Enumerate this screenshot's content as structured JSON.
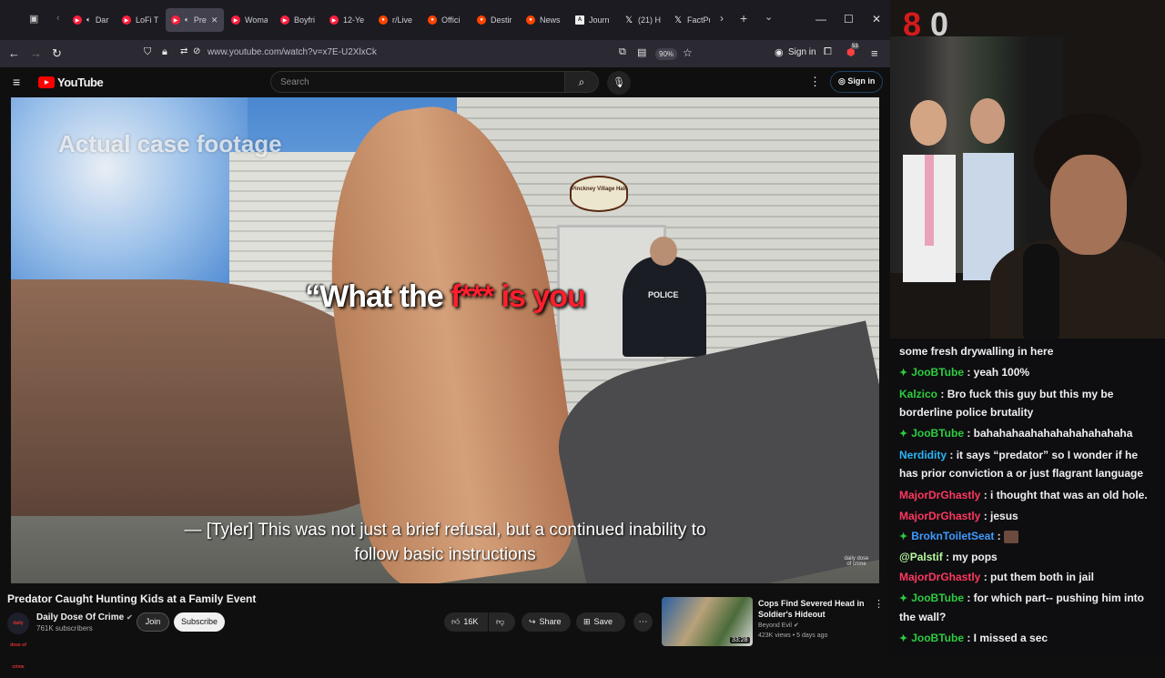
{
  "browser": {
    "tabs": [
      {
        "label": "Dark S",
        "favicon": "youtube",
        "audio": true,
        "active": false
      },
      {
        "label": "LoFi Ti",
        "favicon": "youtube",
        "audio": false,
        "active": false
      },
      {
        "label": "Pre",
        "favicon": "youtube",
        "audio": true,
        "active": true
      },
      {
        "label": "Woma",
        "favicon": "youtube",
        "audio": false,
        "active": false
      },
      {
        "label": "Boyfri",
        "favicon": "youtube",
        "audio": false,
        "active": false
      },
      {
        "label": "12-Ye",
        "favicon": "youtube",
        "audio": false,
        "active": false
      },
      {
        "label": "r/Live",
        "favicon": "reddit",
        "audio": false,
        "active": false
      },
      {
        "label": "Offici",
        "favicon": "reddit",
        "audio": false,
        "active": false
      },
      {
        "label": "Destir",
        "favicon": "reddit",
        "audio": false,
        "active": false
      },
      {
        "label": "News",
        "favicon": "reddit",
        "audio": false,
        "active": false
      },
      {
        "label": "Journ",
        "favicon": "doc",
        "audio": false,
        "active": false
      },
      {
        "label": "(21) H",
        "favicon": "x",
        "audio": false,
        "active": false
      },
      {
        "label": "FactPu",
        "favicon": "x",
        "audio": false,
        "active": false
      }
    ],
    "url": "www.youtube.com/watch?v=x7E-U2XlxCk",
    "zoom": "90%",
    "sign_in": "Sign in",
    "extension_badge": "53"
  },
  "youtube": {
    "logo_text": "YouTube",
    "search_placeholder": "Search",
    "sign_in": "Sign in",
    "video": {
      "watermark": "Actual case footage",
      "caption_white": "“What the ",
      "caption_red": "f*** is you",
      "subtitle_line1": "— [Tyler] This was not just a brief refusal, but a continued inability to",
      "subtitle_line2": "follow basic instructions",
      "sign_text": "Pinckney Village Hall",
      "police_label": "POLICE",
      "corner_logo": "daily dose of crime"
    },
    "title": "Predator Caught Hunting Kids at a Family Event",
    "channel": {
      "name": "Daily Dose Of Crime",
      "subscribers": "761K subscribers",
      "avatar_text": "daily dose of crime",
      "join_label": "Join",
      "subscribe_label": "Subscribe"
    },
    "actions": {
      "likes": "16K",
      "share": "Share",
      "save": "Save"
    },
    "recommended": {
      "title": "Cops Find Severed Head in Soldier's Hideout",
      "channel": "Beyond Evil",
      "meta": "423K views • 5 days ago",
      "duration": "33:28"
    }
  },
  "stream": {
    "badge_red": "8",
    "badge_grey": "0",
    "chat": [
      {
        "user": "",
        "color": "#efeff1",
        "badge": false,
        "text": "some fresh drywalling in here"
      },
      {
        "user": "JooBTube",
        "color": "#2ecc40",
        "badge": true,
        "text": "yeah 100%"
      },
      {
        "user": "Kalzico",
        "color": "#2ecc40",
        "badge": false,
        "text": "Bro fuck this guy but this my be borderline police brutality"
      },
      {
        "user": "JooBTube",
        "color": "#2ecc40",
        "badge": true,
        "text": "bahahahaahahahahahahahaha"
      },
      {
        "user": "Nerdidity",
        "color": "#29b6f6",
        "badge": false,
        "text": "it says “predator” so I wonder if he has prior conviction a or just flagrant language"
      },
      {
        "user": "MajorDrGhastly",
        "color": "#ff3860",
        "badge": false,
        "text": "i thought that was an old hole."
      },
      {
        "user": "MajorDrGhastly",
        "color": "#ff3860",
        "badge": false,
        "text": "jesus"
      },
      {
        "user": "BroknToiletSeat",
        "color": "#3d9bff",
        "badge": true,
        "text": ""
      },
      {
        "user": "@Palstif",
        "color": "#b7f7a0",
        "badge": false,
        "text": "my pops"
      },
      {
        "user": "MajorDrGhastly",
        "color": "#ff3860",
        "badge": false,
        "text": "put them both in jail"
      },
      {
        "user": "JooBTube",
        "color": "#2ecc40",
        "badge": true,
        "text": "for which part-- pushing him into the wall?"
      },
      {
        "user": "JooBTube",
        "color": "#2ecc40",
        "badge": true,
        "text": "I missed a sec"
      }
    ]
  }
}
